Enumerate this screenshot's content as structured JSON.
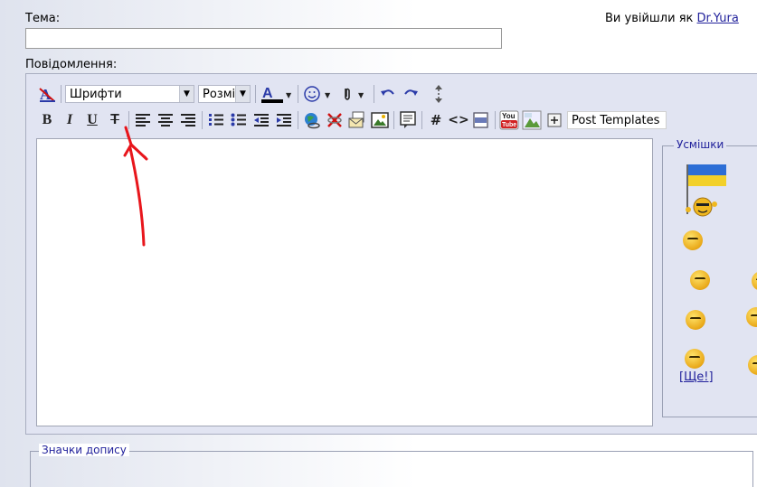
{
  "subject": {
    "label": "Тема:",
    "value": "",
    "placeholder": ""
  },
  "login": {
    "text": "Ви увійшли як ",
    "user": "Dr.Yura"
  },
  "message_label": "Повідомлення:",
  "toolbar": {
    "fonts_select": "Шрифти",
    "size_select": "Розмі",
    "post_templates": "Post Templates"
  },
  "editor": {
    "value": ""
  },
  "smilies": {
    "legend": "Усмішки",
    "more_link": "[Ще!]"
  },
  "post_icons": {
    "legend": "Значки допису"
  },
  "colors": {
    "accent": "#22229c",
    "annotation_arrow": "#e8161c",
    "panel_bg": "#e1e4f2"
  }
}
